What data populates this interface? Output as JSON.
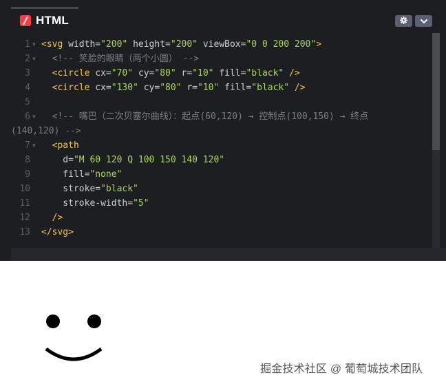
{
  "panel": {
    "title": "HTML",
    "settings_icon": "gear-icon",
    "menu_icon": "chevron-down-icon"
  },
  "code_lines": [
    {
      "n": "1",
      "fold": true,
      "parts": [
        [
          "tag",
          "<svg "
        ],
        [
          "attr",
          "width="
        ],
        [
          "val",
          "\"200\""
        ],
        [
          "attr",
          " height="
        ],
        [
          "val",
          "\"200\""
        ],
        [
          "attr",
          " viewBox="
        ],
        [
          "val",
          "\"0 0 200 200\""
        ],
        [
          "tag",
          ">"
        ]
      ]
    },
    {
      "n": "2",
      "fold": true,
      "parts": [
        [
          "cmt",
          "  <!-- 笑脸的眼睛（两个小圆） -->"
        ]
      ]
    },
    {
      "n": "3",
      "fold": false,
      "parts": [
        [
          "tag",
          "  <circle "
        ],
        [
          "attr",
          "cx="
        ],
        [
          "val",
          "\"70\""
        ],
        [
          "attr",
          " cy="
        ],
        [
          "val",
          "\"80\""
        ],
        [
          "attr",
          " r="
        ],
        [
          "val",
          "\"10\""
        ],
        [
          "attr",
          " fill="
        ],
        [
          "val",
          "\"black\""
        ],
        [
          "tag",
          " />"
        ]
      ]
    },
    {
      "n": "4",
      "fold": false,
      "parts": [
        [
          "tag",
          "  <circle "
        ],
        [
          "attr",
          "cx="
        ],
        [
          "val",
          "\"130\""
        ],
        [
          "attr",
          " cy="
        ],
        [
          "val",
          "\"80\""
        ],
        [
          "attr",
          " r="
        ],
        [
          "val",
          "\"10\""
        ],
        [
          "attr",
          " fill="
        ],
        [
          "val",
          "\"black\""
        ],
        [
          "tag",
          " />"
        ]
      ]
    },
    {
      "n": "5",
      "fold": false,
      "parts": []
    },
    {
      "n": "6",
      "fold": true,
      "parts": [
        [
          "cmt",
          "  <!-- 嘴巴（二次贝塞尔曲线）：起点(60,120) → 控制点(100,150) → 终点"
        ]
      ]
    },
    {
      "n": "",
      "fold": false,
      "parts": [
        [
          "cmt",
          "(140,120) -->"
        ]
      ]
    },
    {
      "n": "7",
      "fold": true,
      "parts": [
        [
          "tag",
          "  <path"
        ]
      ]
    },
    {
      "n": "8",
      "fold": false,
      "parts": [
        [
          "attr",
          "    d="
        ],
        [
          "val",
          "\"M 60 120 Q 100 150 140 120\""
        ]
      ]
    },
    {
      "n": "9",
      "fold": false,
      "parts": [
        [
          "attr",
          "    fill="
        ],
        [
          "val",
          "\"none\""
        ]
      ]
    },
    {
      "n": "10",
      "fold": false,
      "parts": [
        [
          "attr",
          "    stroke="
        ],
        [
          "val",
          "\"black\""
        ]
      ]
    },
    {
      "n": "11",
      "fold": false,
      "parts": [
        [
          "attr",
          "    stroke-width="
        ],
        [
          "val",
          "\"5\""
        ]
      ]
    },
    {
      "n": "12",
      "fold": false,
      "parts": [
        [
          "tag",
          "  />"
        ]
      ]
    },
    {
      "n": "13",
      "fold": false,
      "parts": [
        [
          "tag",
          "</svg>"
        ]
      ]
    }
  ],
  "watermark": "掘金技术社区 @ 葡萄城技术团队",
  "colors": {
    "editor_bg": "#1d1e22",
    "tag": "#f6c346",
    "value": "#a8db53",
    "comment": "#7a7d86",
    "badge": "#ff3c41"
  }
}
